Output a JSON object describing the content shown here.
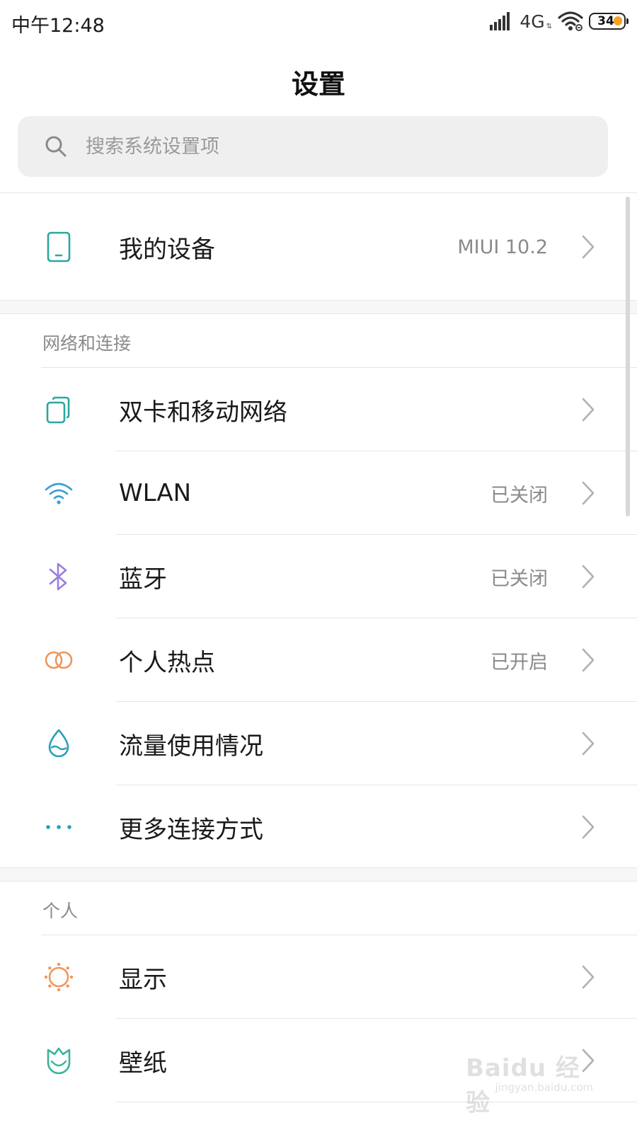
{
  "status_bar": {
    "time": "中午12:48",
    "network": "4G",
    "battery": "34",
    "battery_color": "#f2a321"
  },
  "header": {
    "title": "设置"
  },
  "search": {
    "placeholder": "搜索系统设置项",
    "icon": "search-icon"
  },
  "my_device": {
    "label": "我的设备",
    "value": "MIUI 10.2",
    "icon": "phone-icon",
    "icon_color": "#2aa7a0"
  },
  "sections": [
    {
      "header": "网络和连接",
      "items": [
        {
          "label": "双卡和移动网络",
          "value": "",
          "icon": "sim-cards-icon",
          "icon_color": "#2aa7a0"
        },
        {
          "label": "WLAN",
          "value": "已关闭",
          "icon": "wifi-icon",
          "icon_color": "#3a9fd8"
        },
        {
          "label": "蓝牙",
          "value": "已关闭",
          "icon": "bluetooth-icon",
          "icon_color": "#9b7de0"
        },
        {
          "label": "个人热点",
          "value": "已开启",
          "icon": "hotspot-icon",
          "icon_color": "#f0965a"
        },
        {
          "label": "流量使用情况",
          "value": "",
          "icon": "data-usage-icon",
          "icon_color": "#2a9fb8"
        },
        {
          "label": "更多连接方式",
          "value": "",
          "icon": "more-icon",
          "icon_color": "#2a9fb8"
        }
      ]
    },
    {
      "header": "个人",
      "items": [
        {
          "label": "显示",
          "value": "",
          "icon": "display-icon",
          "icon_color": "#f0965a"
        },
        {
          "label": "壁纸",
          "value": "",
          "icon": "wallpaper-icon",
          "icon_color": "#3ab39a"
        }
      ]
    }
  ],
  "watermark": {
    "brand": "Baidu 经验",
    "url": "jingyan.baidu.com"
  }
}
